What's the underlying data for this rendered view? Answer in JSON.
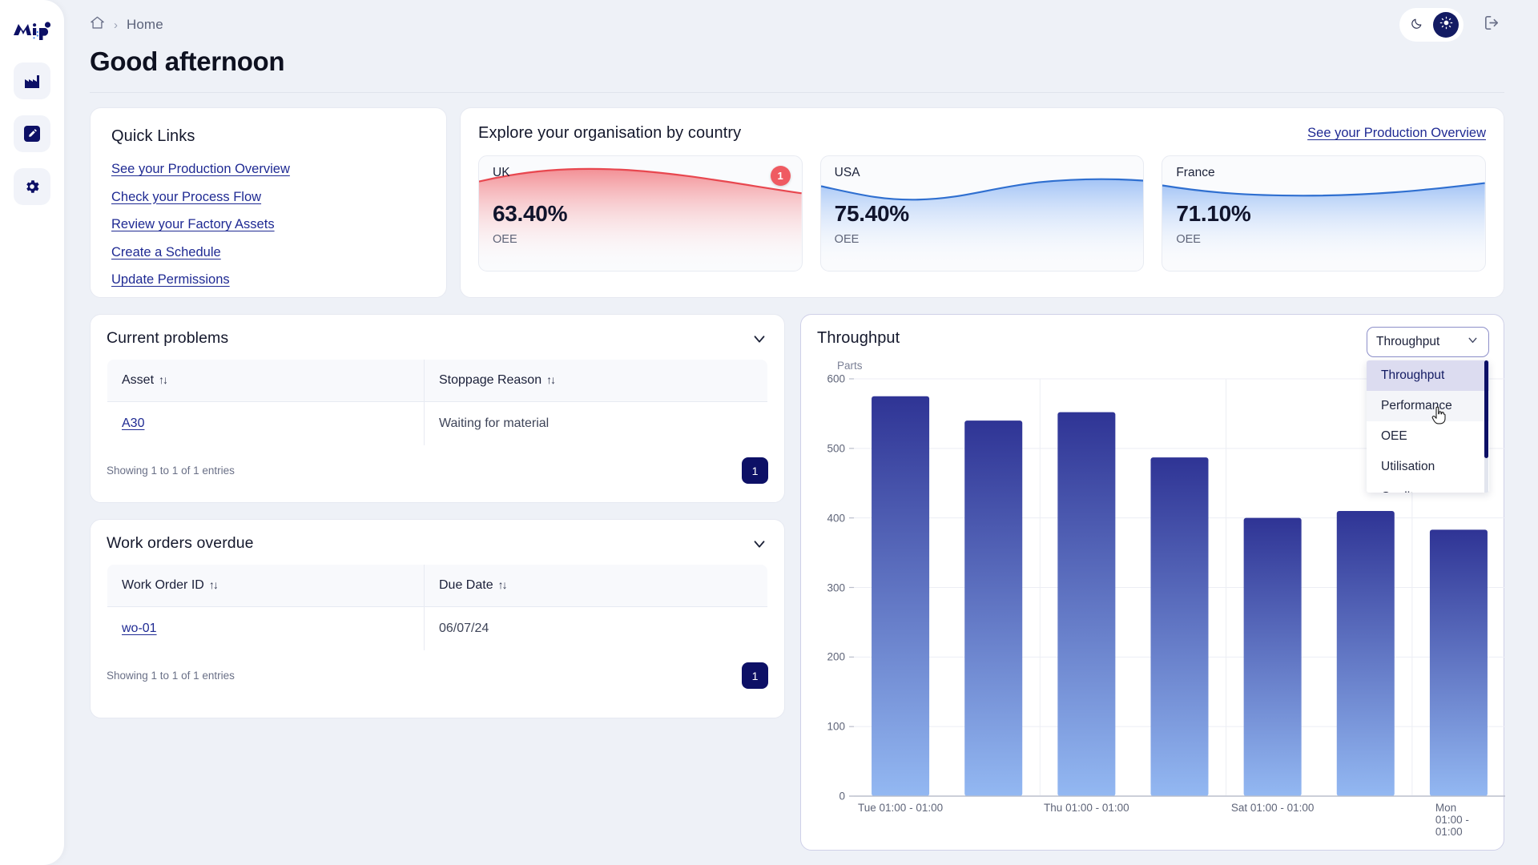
{
  "brand": {
    "logo_text": "MiP",
    "accent": "#0d1066",
    "link_color": "#1f2a93"
  },
  "sidebar": {
    "items": [
      {
        "name": "factory-nav",
        "icon": "factory-icon",
        "label": "Factory"
      },
      {
        "name": "edit-nav",
        "icon": "pencil-square-icon",
        "label": "Edit"
      },
      {
        "name": "settings-nav",
        "icon": "gear-icon",
        "label": "Settings"
      }
    ]
  },
  "topbar": {
    "breadcrumb": {
      "home_icon": "home-icon",
      "separator": "›",
      "current": "Home"
    },
    "theme": {
      "dark_icon": "moon-icon",
      "light_icon": "sun-icon",
      "active": "light"
    },
    "logout_icon": "logout-icon"
  },
  "page": {
    "title": "Good afternoon"
  },
  "quick_links": {
    "title": "Quick Links",
    "links": [
      "See your Production Overview",
      "Check your Process Flow",
      "Review your Factory Assets",
      "Create a Schedule",
      "Update Permissions"
    ]
  },
  "countries": {
    "title": "Explore your organisation by country",
    "overview_link": "See your Production Overview",
    "cards": [
      {
        "name": "UK",
        "value": "63.40%",
        "metric": "OEE",
        "badge": "1",
        "color": "#e8474f",
        "fill": "#f2868c"
      },
      {
        "name": "USA",
        "value": "75.40%",
        "metric": "OEE",
        "badge": null,
        "color": "#2f6fd0",
        "fill": "#9dc0f5"
      },
      {
        "name": "France",
        "value": "71.10%",
        "metric": "OEE",
        "badge": null,
        "color": "#2f6fd0",
        "fill": "#9dc0f5"
      }
    ]
  },
  "problems": {
    "title": "Current problems",
    "collapse_icon": "chevron-down-icon",
    "columns": [
      "Asset",
      "Stoppage Reason"
    ],
    "rows": [
      {
        "asset": "A30",
        "reason": "Waiting for material"
      }
    ],
    "footer": "Showing 1 to 1 of 1 entries",
    "page": "1"
  },
  "work_orders": {
    "title": "Work orders overdue",
    "collapse_icon": "chevron-down-icon",
    "columns": [
      "Work Order ID",
      "Due Date"
    ],
    "rows": [
      {
        "id": "wo-01",
        "due": "06/07/24"
      }
    ],
    "footer": "Showing 1 to 1 of 1 entries",
    "page": "1"
  },
  "throughput": {
    "title": "Throughput",
    "select": {
      "value": "Throughput",
      "chevron_icon": "chevron-down-icon",
      "options": [
        "Throughput",
        "Performance",
        "OEE",
        "Utilisation",
        "Quality"
      ],
      "selected_index": 0,
      "hovered_index": 1,
      "open": true
    }
  },
  "chart_data": {
    "type": "bar",
    "title": "Throughput",
    "xlabel": "",
    "ylabel": "Parts",
    "ylim": [
      0,
      600
    ],
    "yticks": [
      0,
      100,
      200,
      300,
      400,
      500,
      600
    ],
    "grid": true,
    "legend": "none",
    "categories": [
      "Tue 01:00 - 01:00",
      "",
      "Thu 01:00 - 01:00",
      "",
      "Sat 01:00 - 01:00",
      "",
      "Mon 01:00 - 01:00"
    ],
    "xtick_labels": [
      "Tue 01:00 - 01:00",
      "Thu 01:00 - 01:00",
      "Sat 01:00 - 01:00",
      "Mon 01:00 - 01:00"
    ],
    "values": [
      575,
      540,
      552,
      487,
      400,
      410,
      383
    ],
    "bar_gradient": {
      "top": "#2f3495",
      "bottom": "#93b8f2"
    }
  }
}
